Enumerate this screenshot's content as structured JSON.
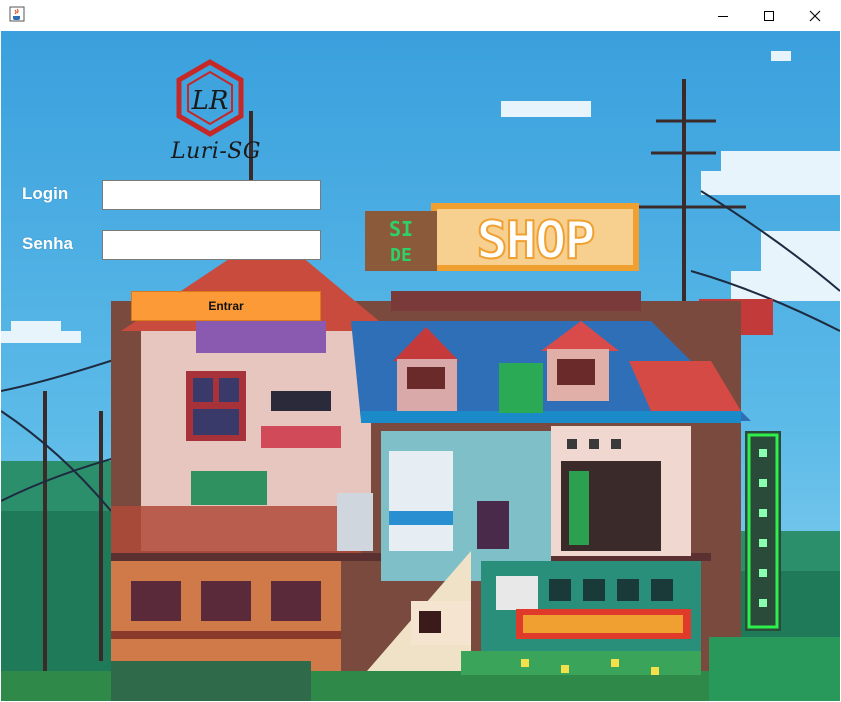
{
  "window": {
    "icon": "java-cup-icon",
    "controls": [
      "minimize-icon",
      "maximize-icon",
      "close-icon"
    ]
  },
  "logo": {
    "monogram": "LR",
    "text": "Luri-SG",
    "color": "#c62828"
  },
  "form": {
    "login_label": "Login",
    "login_value": "",
    "password_label": "Senha",
    "password_value": "",
    "submit_label": "Entrar"
  },
  "background": {
    "sign_shop": "SHOP",
    "sign_side": "SI DE"
  },
  "colors": {
    "accent": "#fb9a36",
    "sky": "#3aa7e0"
  }
}
